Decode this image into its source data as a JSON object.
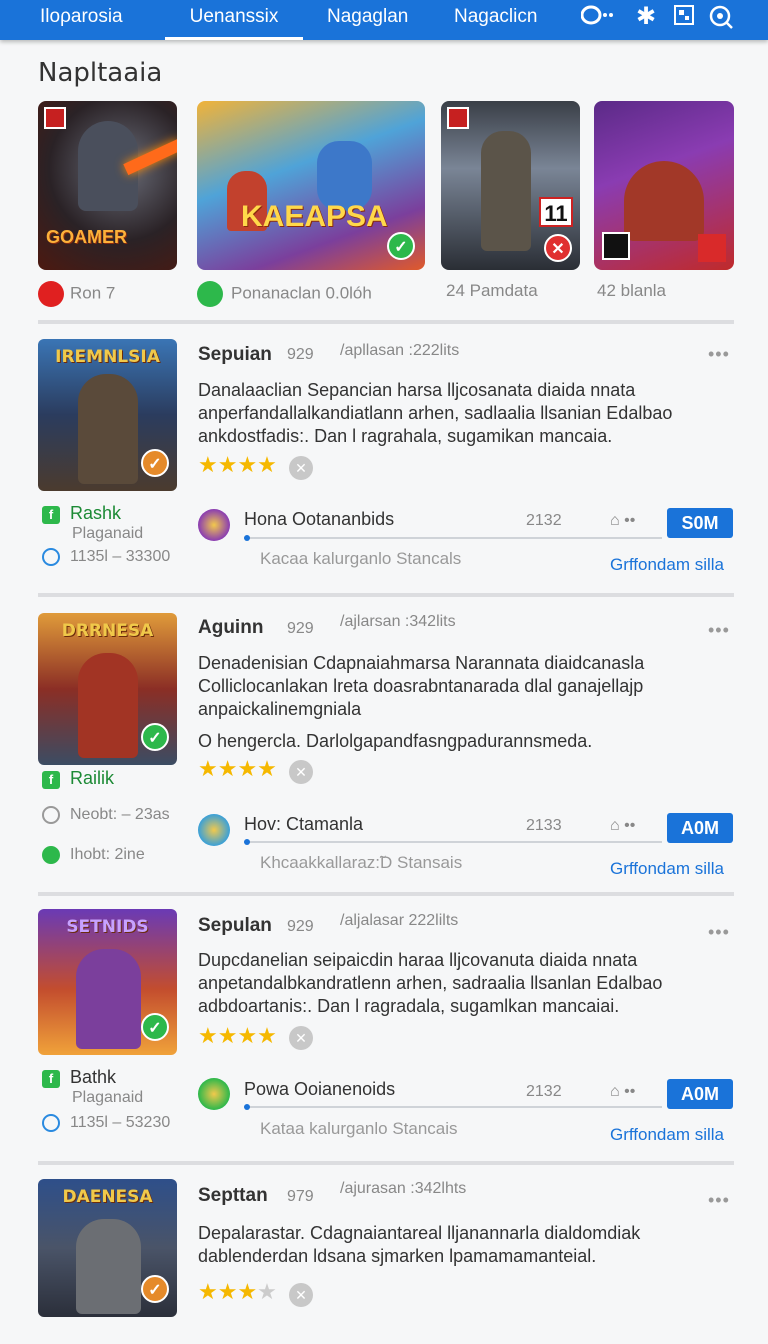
{
  "nav": {
    "tabs": [
      "Iloρarosia",
      "Uenanssix",
      "Nagaglan",
      "Nagaclicn"
    ],
    "icons": [
      "gamepad-icon",
      "star-icon",
      "grid-icon",
      "search-icon"
    ]
  },
  "section_title": "Napltaaia",
  "featured": [
    {
      "logo": "GOAMER",
      "meta": "Ron 7"
    },
    {
      "logo": "KAEAPSA",
      "meta": "Ponanaclan 0.0lóh"
    },
    {
      "logo": "",
      "meta": "24 Pamdata"
    },
    {
      "logo": "",
      "meta": "42 blanla"
    }
  ],
  "cards": [
    {
      "thumb_title": "IREMNLSIA",
      "title": "Sepuian",
      "num": "929",
      "meta": "/apllasan :222lits",
      "desc": "Danalaaclian Sepancian harsa lljcosanata diaida nnata anperfandallalkandiatlann arhen, sadlaalia llsanian Edalbao ankdostfadis:. Dan l ragrahala, sugamikan mancaia.",
      "side_label": "Rashk",
      "side_sub": "Plaganaid",
      "side_num": "1135l – 33300",
      "dev_name": "Hona Ootananbids",
      "dev_count": "2132",
      "btn": "S0M",
      "sub": "Kacaa kalurganlo Stancals",
      "link": "Grffondam silla"
    },
    {
      "thumb_title": "DRRNESA",
      "title": "Aguinn",
      "num": "929",
      "meta": "/ajlarsan :342lits",
      "desc": "Denadenisian Cdapnaiahmarsa Narannata diaidcanasla Colliclocanlakan lreta doasrabntanarada dlal ganajellajp anpaickalinemgniala",
      "desc2": "O hengercla. Darlolgapandfasngpadurannsmeda.",
      "side_label": "Railik",
      "side_row2": "Neobt: – 23as",
      "side_row3": "Ihobt: 2ine",
      "dev_name": "Hov: Ctamanla",
      "dev_count": "2133",
      "btn": "A0M",
      "sub": "Khcaakkallaraz:̃D Stansais",
      "link": "Grffondam silla"
    },
    {
      "thumb_title": "SETNIDS",
      "title": "Sepulan",
      "num": "929",
      "meta": "/aljalasar 222lilts",
      "desc": "Dupcdanelian seipaicdin haraa lljcovanuta diaida nnata anpetandalbkandratlenn arhen, sadraalia llsanlan Edalbao adbdoartanis:. Dan l ragradala, sugamlkan mancaiai.",
      "side_label": "Bathk",
      "side_sub": "Plaganaid",
      "side_num": "1135l – 53230",
      "dev_name": "Powa Ooianenoids",
      "dev_count": "2132",
      "btn": "A0M",
      "sub": "Kataa kalurganlo Stancais",
      "link": "Grffondam silla"
    },
    {
      "thumb_title": "DAENESA",
      "title": "Septtan",
      "num": "979",
      "meta": "/ajurasan :342lhts",
      "desc": "Depalarastar. Cdagnaiantareal lljanannarla dialdomdiak dablenderdan ldsana sjmarken lpamamamanteial."
    }
  ],
  "colors": {
    "accent": "#1a73d9",
    "green": "#2db84b",
    "star": "#f5b800"
  }
}
